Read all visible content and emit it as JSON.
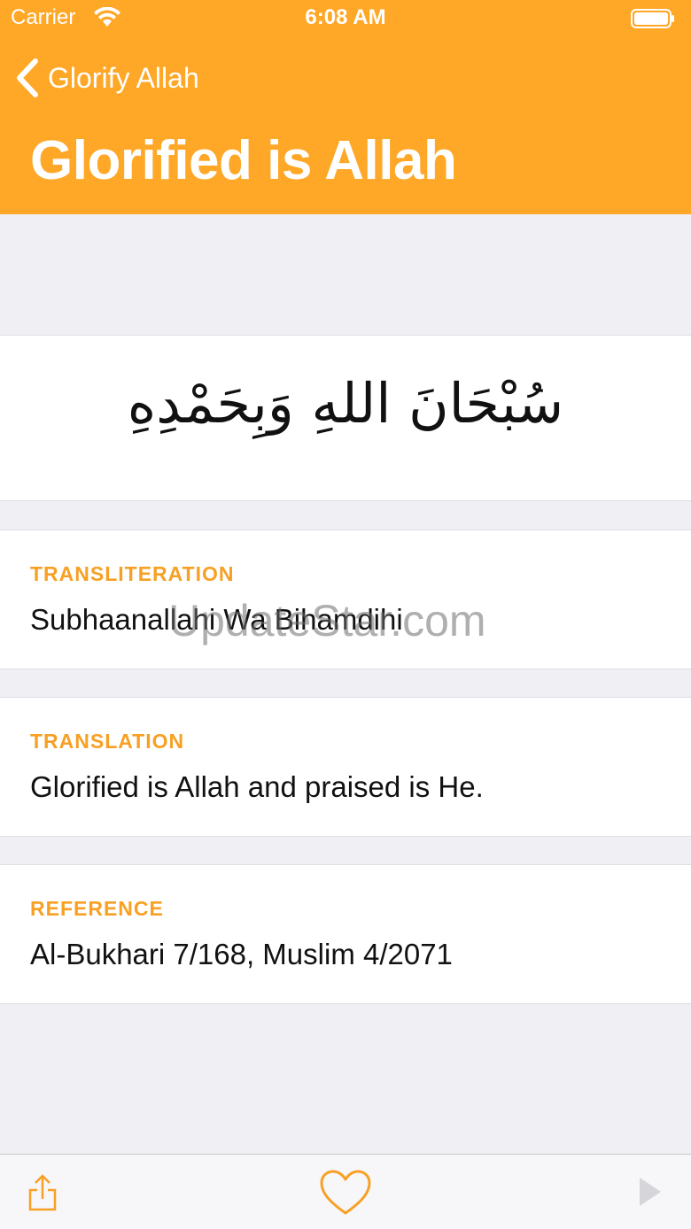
{
  "status_bar": {
    "carrier": "Carrier",
    "time": "6:08 AM",
    "wifi_icon": "wifi-icon",
    "battery_icon": "battery-icon"
  },
  "nav": {
    "back_label": "Glorify Allah",
    "title": "Glorified is Allah"
  },
  "dhikr": {
    "arabic": "سُبْحَانَ اللهِ وَبِحَمْدِهِ"
  },
  "sections": [
    {
      "label": "TRANSLITERATION",
      "value": "Subhaanallahi Wa Bihamdihi"
    },
    {
      "label": "TRANSLATION",
      "value": "Glorified is Allah and praised is He."
    },
    {
      "label": "REFERENCE",
      "value": "Al-Bukhari 7/168, Muslim 4/2071"
    }
  ],
  "watermark": "UpdateStar.com",
  "toolbar": {
    "share_icon": "share-icon",
    "favorite_icon": "heart-icon",
    "play_icon": "play-icon"
  },
  "colors": {
    "accent": "#ffa726",
    "label": "#f7a024",
    "background": "#efeff4"
  }
}
